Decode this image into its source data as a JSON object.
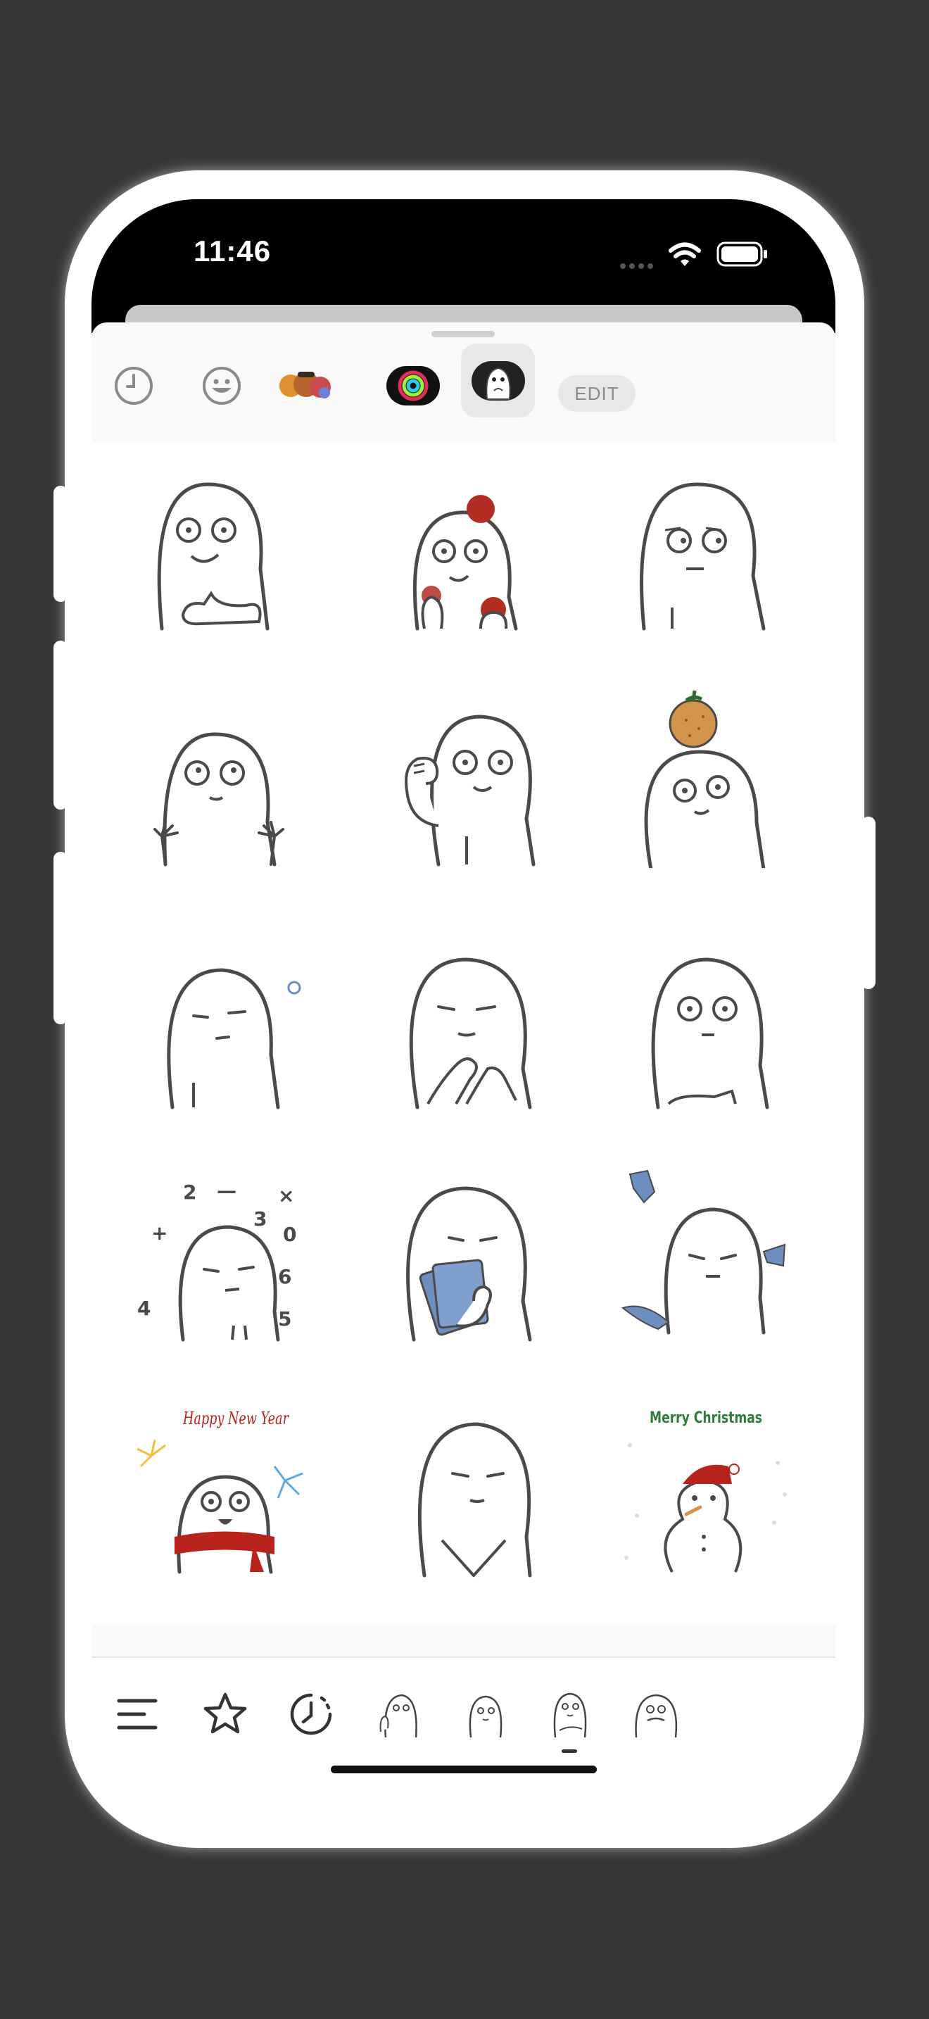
{
  "status_bar": {
    "time": "11:46"
  },
  "sticker_picker": {
    "tabs": [
      {
        "name": "recents",
        "icon": "clock-icon"
      },
      {
        "name": "emoji",
        "icon": "smiley-icon"
      },
      {
        "name": "memoji",
        "icon": "memoji-icon"
      },
      {
        "name": "activity",
        "icon": "activity-rings-icon"
      },
      {
        "name": "sticker-app",
        "icon": "ghost-sticker-icon",
        "selected": true
      }
    ],
    "edit_label": "EDIT"
  },
  "stickers": [
    {
      "name": "thumbs-up"
    },
    {
      "name": "juggling-apples"
    },
    {
      "name": "side-eye"
    },
    {
      "name": "hands-up"
    },
    {
      "name": "fist-pump"
    },
    {
      "name": "orange-on-head"
    },
    {
      "name": "sleepy-bubble"
    },
    {
      "name": "praying"
    },
    {
      "name": "arms-crossed"
    },
    {
      "name": "math-thinking"
    },
    {
      "name": "holding-cash"
    },
    {
      "name": "throwing-money"
    },
    {
      "name": "happy-new-year",
      "text": "Happy New Year"
    },
    {
      "name": "calm-crossed-arms"
    },
    {
      "name": "merry-christmas",
      "text": "Merry Christmas"
    }
  ],
  "bottom_bar": {
    "items": [
      {
        "name": "categories",
        "icon": "menu-lines-icon"
      },
      {
        "name": "favorites",
        "icon": "star-icon"
      },
      {
        "name": "recent",
        "icon": "recent-clock-icon"
      },
      {
        "name": "pack-1",
        "icon": "ghost-thumbs-icon"
      },
      {
        "name": "pack-2",
        "icon": "ghost-plain-icon"
      },
      {
        "name": "pack-3",
        "icon": "ghost-arms-icon",
        "selected": true
      },
      {
        "name": "pack-4",
        "icon": "ghost-mustache-icon"
      }
    ]
  },
  "colors": {
    "background": "#363636",
    "stroke": "#4a4a4a",
    "apple_red": "#b22e22",
    "orange": "#d2934a",
    "scarf_red": "#b8231b",
    "christmas_green": "#2e7d3a",
    "cash_blue": "#6d8fc0"
  }
}
